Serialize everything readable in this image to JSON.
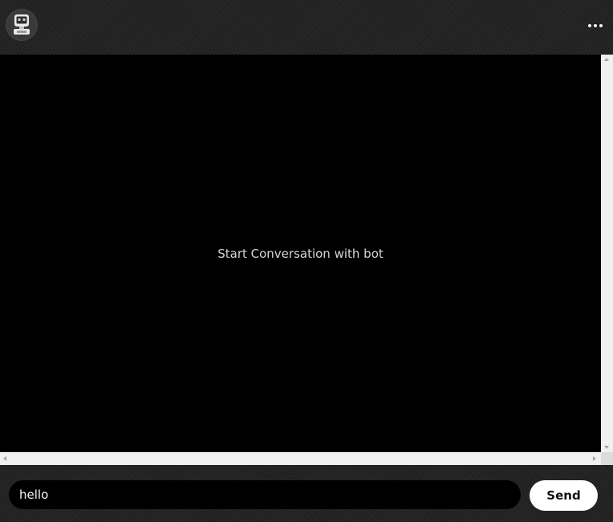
{
  "header": {
    "avatar_icon": "robot-icon",
    "menu_icon": "more-horizontal-icon"
  },
  "chat": {
    "empty_state_text": "Start Conversation with bot"
  },
  "composer": {
    "input_value": "hello",
    "input_placeholder": "",
    "send_label": "Send"
  },
  "colors": {
    "chat_background": "#000000",
    "frame_background": "#242424",
    "send_button_background": "#ffffff",
    "input_background": "#000000",
    "text_primary": "#d6d6d6"
  }
}
